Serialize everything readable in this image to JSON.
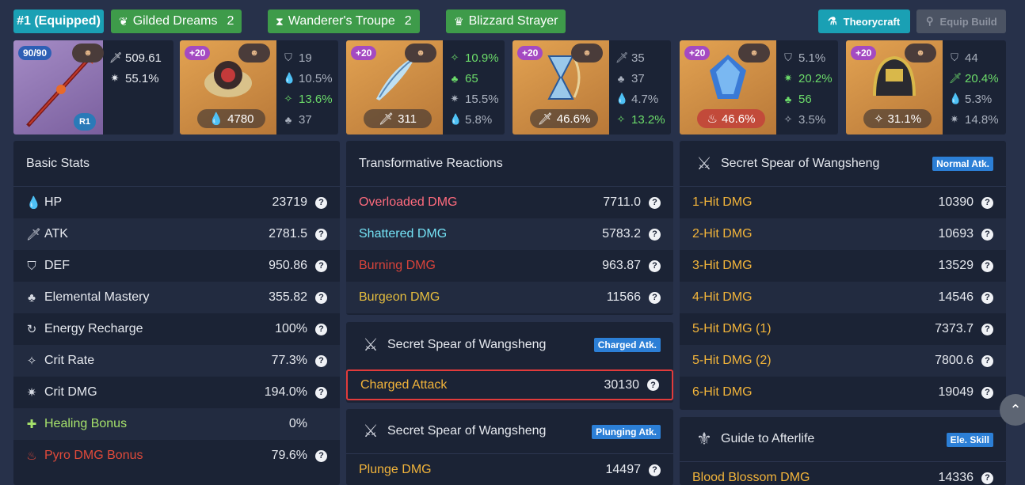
{
  "topbar": {
    "equipped": "#1 (Equipped)",
    "sets": [
      {
        "name": "Gilded Dreams",
        "count": "2",
        "icon": "leaf-crown-icon"
      },
      {
        "name": "Wanderer's Troupe",
        "count": "2",
        "icon": "hourglass-icon"
      },
      {
        "name": "Blizzard Strayer",
        "count": "",
        "icon": "trophy-icon"
      }
    ],
    "theorycraft": "Theorycraft",
    "equip_build": "Equip Build"
  },
  "weapon": {
    "level": "90/90",
    "refine": "R1",
    "atk": "509.61",
    "crit_dmg": "55.1%"
  },
  "artifacts": [
    {
      "level": "+20",
      "main": "4780",
      "subs": [
        "19",
        "10.5%",
        "13.6%",
        "37"
      ],
      "hi": [
        false,
        false,
        true,
        false
      ]
    },
    {
      "level": "+20",
      "main": "311",
      "subs": [
        "10.9%",
        "65",
        "15.5%",
        "5.8%"
      ],
      "hi": [
        true,
        true,
        false,
        false
      ]
    },
    {
      "level": "+20",
      "main": "46.6%",
      "subs": [
        "35",
        "37",
        "4.7%",
        "13.2%"
      ],
      "hi": [
        false,
        false,
        false,
        true
      ]
    },
    {
      "level": "+20",
      "main": "46.6%",
      "subs": [
        "5.1%",
        "20.2%",
        "56",
        "3.5%"
      ],
      "hi": [
        false,
        true,
        true,
        false
      ]
    },
    {
      "level": "+20",
      "main": "31.1%",
      "subs": [
        "44",
        "20.4%",
        "5.3%",
        "14.8%"
      ],
      "hi": [
        false,
        true,
        false,
        false
      ]
    }
  ],
  "basic": {
    "title": "Basic Stats",
    "rows": [
      {
        "label": "HP",
        "value": "23719"
      },
      {
        "label": "ATK",
        "value": "2781.5"
      },
      {
        "label": "DEF",
        "value": "950.86"
      },
      {
        "label": "Elemental Mastery",
        "value": "355.82"
      },
      {
        "label": "Energy Recharge",
        "value": "100%"
      },
      {
        "label": "Crit Rate",
        "value": "77.3%"
      },
      {
        "label": "Crit DMG",
        "value": "194.0%"
      },
      {
        "label": "Healing Bonus",
        "value": "0%"
      },
      {
        "label": "Pyro DMG Bonus",
        "value": "79.6%"
      }
    ]
  },
  "transformative": {
    "title": "Transformative Reactions",
    "rows": [
      {
        "label": "Overloaded DMG",
        "value": "7711.0"
      },
      {
        "label": "Shattered DMG",
        "value": "5783.2"
      },
      {
        "label": "Burning DMG",
        "value": "963.87"
      },
      {
        "label": "Burgeon DMG",
        "value": "11566"
      }
    ]
  },
  "charged": {
    "title": "Secret Spear of Wangsheng",
    "tag": "Charged Atk.",
    "label": "Charged Attack",
    "value": "30130"
  },
  "plunging": {
    "title": "Secret Spear of Wangsheng",
    "tag": "Plunging Atk.",
    "label": "Plunge DMG",
    "value": "14497"
  },
  "normal": {
    "title": "Secret Spear of Wangsheng",
    "tag": "Normal Atk.",
    "rows": [
      {
        "label": "1-Hit DMG",
        "value": "10390"
      },
      {
        "label": "2-Hit DMG",
        "value": "10693"
      },
      {
        "label": "3-Hit DMG",
        "value": "13529"
      },
      {
        "label": "4-Hit DMG",
        "value": "14546"
      },
      {
        "label": "5-Hit DMG (1)",
        "value": "7373.7"
      },
      {
        "label": "5-Hit DMG (2)",
        "value": "7800.6"
      },
      {
        "label": "6-Hit DMG",
        "value": "19049"
      }
    ]
  },
  "skill": {
    "title": "Guide to Afterlife",
    "tag": "Ele. Skill",
    "label": "Blood Blossom DMG",
    "value": "14336"
  },
  "colors": {
    "accent": "#1aa0b4",
    "set_green": "#3e9b4a",
    "panel": "#1b2335",
    "bg": "#27314a",
    "highlight": "#e23b3b"
  }
}
